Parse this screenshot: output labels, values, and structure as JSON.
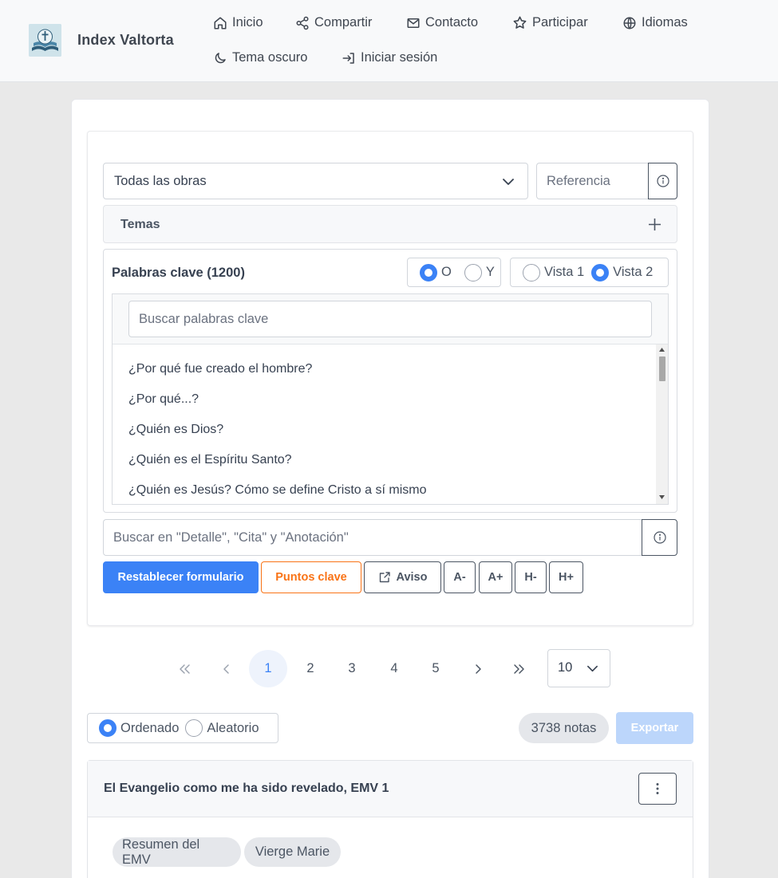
{
  "header": {
    "brand": "Index Valtorta",
    "nav": [
      {
        "label": "Inicio",
        "icon": "home-icon"
      },
      {
        "label": "Compartir",
        "icon": "share-icon"
      },
      {
        "label": "Contacto",
        "icon": "mail-icon"
      },
      {
        "label": "Participar",
        "icon": "star-icon"
      },
      {
        "label": "Idiomas",
        "icon": "globe-icon"
      },
      {
        "label": "Tema oscuro",
        "icon": "moon-icon"
      },
      {
        "label": "Iniciar sesión",
        "icon": "login-icon"
      }
    ]
  },
  "form": {
    "works_select": "Todas las obras",
    "reference_placeholder": "Referencia",
    "themes_label": "Temas",
    "keywords_title": "Palabras clave (1200)",
    "logic": {
      "or": "O",
      "and": "Y",
      "selected": "O"
    },
    "view": {
      "v1": "Vista 1",
      "v2": "Vista 2",
      "selected": "Vista 2"
    },
    "keyword_search_placeholder": "Buscar palabras clave",
    "keywords": [
      "¿Por qué fue creado el hombre?",
      "¿Por qué...?",
      "¿Quién es Dios?",
      "¿Quién es el Espíritu Santo?",
      "¿Quién es Jesús? Cómo se define Cristo a sí mismo"
    ],
    "detail_search_placeholder": "Buscar en \"Detalle\", \"Cita\" y \"Anotación\"",
    "buttons": {
      "reset": "Restablecer formulario",
      "key_points": "Puntos clave",
      "notice": "Aviso",
      "font_minus": "A-",
      "font_plus": "A+",
      "height_minus": "H-",
      "height_plus": "H+"
    }
  },
  "pagination": {
    "pages": [
      "1",
      "2",
      "3",
      "4",
      "5"
    ],
    "current": "1",
    "page_size": "10"
  },
  "results": {
    "order": {
      "ordered": "Ordenado",
      "random": "Aleatorio",
      "selected": "Ordenado"
    },
    "count": "3738 notas",
    "export": "Exportar",
    "first": {
      "title": "El Evangelio como me ha sido revelado, EMV 1",
      "tags": [
        "Resumen del EMV",
        "Vierge Marie"
      ]
    }
  },
  "colors": {
    "accent": "#3b82f6",
    "orange": "#f97316",
    "border_dark": "#4b5563"
  }
}
